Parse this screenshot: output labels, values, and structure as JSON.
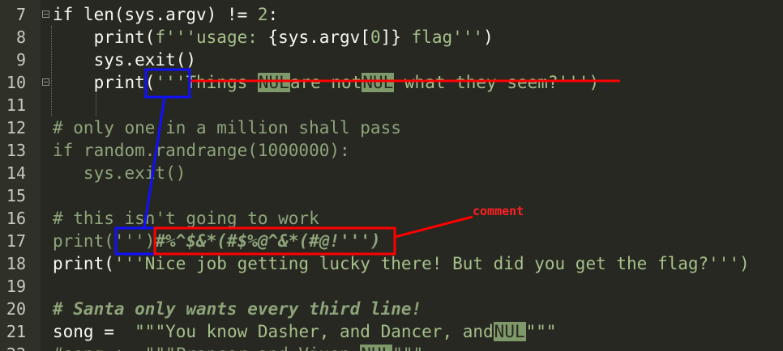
{
  "lines": [
    {
      "num": "7",
      "segments": [
        [
          "if len(sys.argv) != ",
          "plain"
        ],
        [
          "2",
          "num"
        ],
        [
          ":",
          "plain"
        ]
      ]
    },
    {
      "num": "8",
      "segments": [
        [
          "    print(",
          "plain"
        ],
        [
          "f'''usage: ",
          "str"
        ],
        [
          "{sys.argv[",
          "plain"
        ],
        [
          "0",
          "num"
        ],
        [
          "]}",
          "plain"
        ],
        [
          " flag'''",
          "str"
        ],
        [
          ")",
          "plain"
        ]
      ]
    },
    {
      "num": "9",
      "segments": [
        [
          "    sys.exit()",
          "plain"
        ]
      ]
    },
    {
      "num": "10",
      "segments": [
        [
          "    print(",
          "plain"
        ],
        [
          "'''Things ",
          "str"
        ],
        [
          "NUL",
          "nul"
        ],
        [
          "are not",
          "str"
        ],
        [
          "NUL",
          "nul"
        ],
        [
          " what they seem?''')",
          "str"
        ]
      ]
    },
    {
      "num": "11",
      "segments": [
        [
          "",
          "plain"
        ]
      ]
    },
    {
      "num": "12",
      "segments": [
        [
          "# only one in a million shall pass",
          "cmt"
        ]
      ]
    },
    {
      "num": "13",
      "segments": [
        [
          "if random.randrange(1000000):",
          "cmt"
        ]
      ]
    },
    {
      "num": "14",
      "segments": [
        [
          "   sys.exit()",
          "cmt"
        ]
      ]
    },
    {
      "num": "15",
      "segments": [
        [
          "",
          "plain"
        ]
      ]
    },
    {
      "num": "16",
      "segments": [
        [
          "# this isn't going to work",
          "cmt"
        ]
      ]
    },
    {
      "num": "17",
      "segments": [
        [
          "print(",
          "cmt"
        ],
        [
          "'''",
          "cmt"
        ],
        [
          ")",
          "cmt"
        ],
        [
          "#%^$&*(#$%@^&*(#@!''')",
          "cmt-it"
        ]
      ]
    },
    {
      "num": "18",
      "segments": [
        [
          "print(",
          "plain"
        ],
        [
          "'''Nice job getting lucky there! But did you get the flag?''')",
          "str"
        ]
      ]
    },
    {
      "num": "19",
      "segments": [
        [
          "",
          "plain"
        ]
      ]
    },
    {
      "num": "20",
      "segments": [
        [
          "# Santa only wants every third line!",
          "cmt-it"
        ]
      ]
    },
    {
      "num": "21",
      "segments": [
        [
          "song = ",
          "plain"
        ],
        [
          " \"\"\"You know Dasher, and Dancer, and",
          "str"
        ],
        [
          "NUL",
          "nul"
        ],
        [
          "\"\"\"",
          "str"
        ]
      ]
    },
    {
      "num": "22",
      "segments": [
        [
          "#song += \"\"\"Prancer and Vixen,",
          "cmt"
        ],
        [
          "NUL",
          "nul"
        ],
        [
          "\"\"\"",
          "cmt"
        ]
      ]
    }
  ],
  "annotations": {
    "comment_label": "comment"
  },
  "colors": {
    "background": "#272822",
    "annotation_red": "#ff0000",
    "annotation_blue": "#0000ff"
  }
}
